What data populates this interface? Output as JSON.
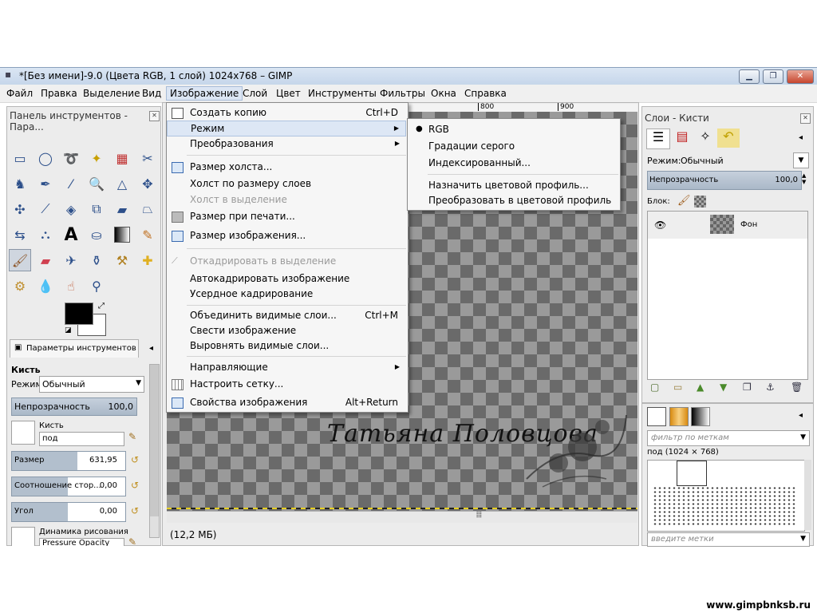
{
  "window": {
    "title": "*[Без имени]-9.0 (Цвета RGB, 1 слой) 1024x768 – GIMP",
    "controls": {
      "minimize": "▁",
      "maximize": "❐",
      "close": "✕"
    }
  },
  "menubar": [
    "Файл",
    "Правка",
    "Выделение",
    "Вид",
    "Изображение",
    "Слой",
    "Цвет",
    "Инструменты",
    "Фильтры",
    "Окна",
    "Справка"
  ],
  "toolbox": {
    "title": "Панель инструментов - Пара...",
    "options_tab": "Параметры инструментов",
    "tool_name": "Кисть",
    "mode_label": "Режим:",
    "mode_value": "Обычный",
    "opacity_label": "Непрозрачность",
    "opacity_value": "100,0",
    "brush_label": "Кисть",
    "brush_value": "под",
    "size_label": "Размер",
    "size_value": "631,95",
    "ratio_label": "Соотношение стор...",
    "ratio_value": "0,00",
    "angle_label": "Угол",
    "angle_value": "0,00",
    "dynamics_label": "Динамика рисования",
    "dynamics_value": "Pressure Opacity"
  },
  "ruler": {
    "marks": [
      "800",
      "900"
    ]
  },
  "status": {
    "memory": "(12,2 МБ)"
  },
  "watermark": "Татьяна Половцова",
  "site": "www.gimpbnksb.ru",
  "image_menu": {
    "items": [
      {
        "label": "Создать копию",
        "shortcut": "Ctrl+D"
      },
      {
        "label": "Режим",
        "submenu": true
      },
      {
        "label": "Преобразования",
        "submenu": true
      },
      {
        "label": "Размер холста..."
      },
      {
        "label": "Холст по размеру слоев"
      },
      {
        "label": "Холст в выделение",
        "disabled": true
      },
      {
        "label": "Размер при печати..."
      },
      {
        "label": "Размер изображения..."
      },
      {
        "label": "Откадрировать в выделение",
        "disabled": true
      },
      {
        "label": "Автокадрировать изображение"
      },
      {
        "label": "Усердное кадрирование"
      },
      {
        "label": "Объединить видимые слои...",
        "shortcut": "Ctrl+M"
      },
      {
        "label": "Свести изображение"
      },
      {
        "label": "Выровнять видимые слои..."
      },
      {
        "label": "Направляющие",
        "submenu": true
      },
      {
        "label": "Настроить сетку..."
      },
      {
        "label": "Свойства изображения",
        "shortcut": "Alt+Return"
      }
    ]
  },
  "mode_submenu": {
    "items": [
      "RGB",
      "Градации серого",
      "Индексированный...",
      "Назначить цветовой профиль...",
      "Преобразовать в цветовой профиль"
    ],
    "selected": "RGB"
  },
  "layers_panel": {
    "title": "Слои - Кисти",
    "mode_label": "Режим:",
    "mode_value": "Обычный",
    "opacity_label": "Непрозрачность",
    "opacity_value": "100,0",
    "lock_label": "Блок:",
    "layer_name": "Фон"
  },
  "brushes_panel": {
    "filter_placeholder": "фильтр по меткам",
    "brush_info": "под (1024 × 768)",
    "tags_placeholder": "введите метки"
  }
}
